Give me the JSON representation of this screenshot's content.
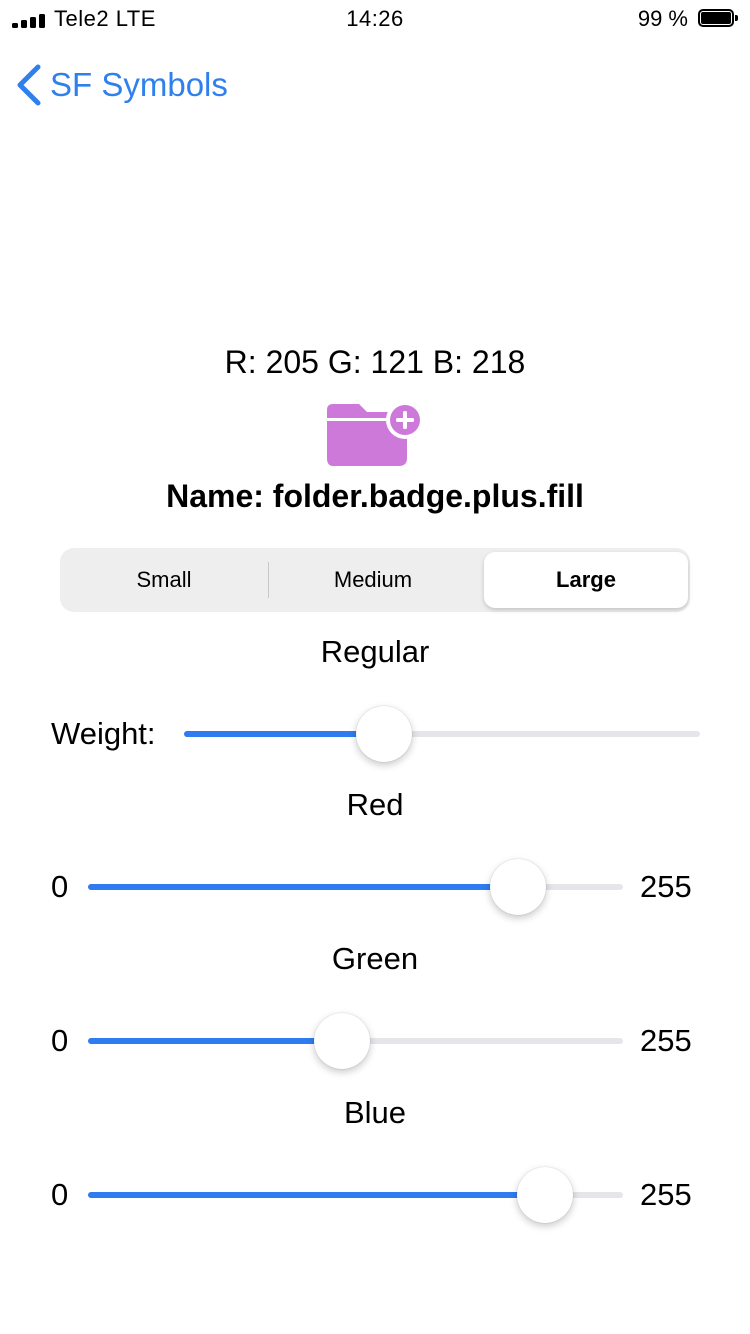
{
  "status_bar": {
    "carrier": "Tele2 LTE",
    "time": "14:26",
    "battery_percent": "99 %"
  },
  "nav": {
    "back_label": "SF Symbols"
  },
  "symbol": {
    "rgb_readout": "R: 205 G: 121 B: 218",
    "name_text": "Name: folder.badge.plus.fill",
    "icon": "folder-badge-plus-fill-icon",
    "color": "#cd79da"
  },
  "size_control": {
    "segments": [
      "Small",
      "Medium",
      "Large"
    ],
    "selected": "Large"
  },
  "weight": {
    "title": "Regular",
    "label": "Weight:",
    "value_fraction": 0.388
  },
  "sliders": {
    "red": {
      "title": "Red",
      "min_label": "0",
      "max_label": "255",
      "value": 205,
      "max": 255
    },
    "green": {
      "title": "Green",
      "min_label": "0",
      "max_label": "255",
      "value": 121,
      "max": 255
    },
    "blue": {
      "title": "Blue",
      "min_label": "0",
      "max_label": "255",
      "value": 218,
      "max": 255
    }
  },
  "colors": {
    "accent": "#2f7cf0",
    "track": "#e5e5ea"
  }
}
